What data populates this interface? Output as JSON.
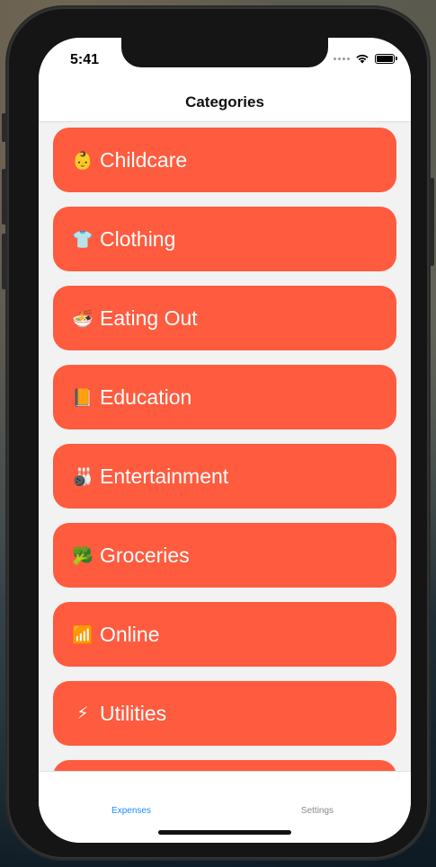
{
  "status_bar": {
    "time": "5:41",
    "signal_icon": "signal-dots-icon",
    "wifi_icon": "wifi-icon",
    "battery_icon": "battery-icon"
  },
  "nav": {
    "title": "Categories"
  },
  "accent_color": "#ff5b3e",
  "tab_active_color": "#1a8cff",
  "categories": [
    {
      "emoji": "👶",
      "label": "Childcare"
    },
    {
      "emoji": "👕",
      "label": "Clothing"
    },
    {
      "emoji": "🍜",
      "label": "Eating Out"
    },
    {
      "emoji": "📙",
      "label": "Education"
    },
    {
      "emoji": "🎳",
      "label": "Entertainment"
    },
    {
      "emoji": "🥦",
      "label": "Groceries"
    },
    {
      "emoji": "📶",
      "label": "Online"
    },
    {
      "emoji": "⚡",
      "label": "Utilities"
    },
    {
      "emoji": "",
      "label": ""
    }
  ],
  "tabs": [
    {
      "label": "Expenses",
      "active": true
    },
    {
      "label": "Settings",
      "active": false
    }
  ]
}
